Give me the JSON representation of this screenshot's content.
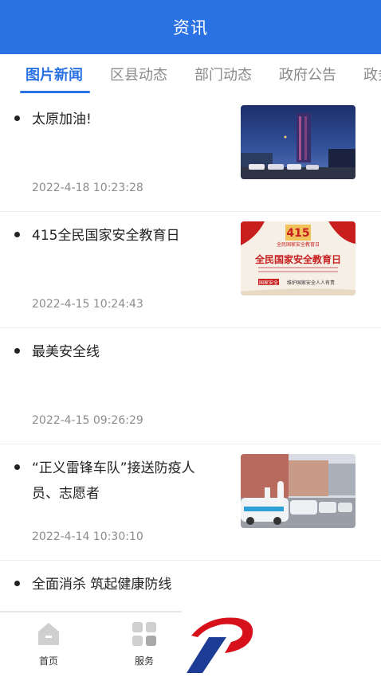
{
  "header": {
    "title": "资讯"
  },
  "tabs": [
    {
      "label": "图片新闻",
      "active": true
    },
    {
      "label": "区县动态",
      "active": false
    },
    {
      "label": "部门动态",
      "active": false
    },
    {
      "label": "政府公告",
      "active": false
    },
    {
      "label": "政务",
      "active": false
    }
  ],
  "news": [
    {
      "title": "太原加油!",
      "date": "2022-4-18 10:23:28",
      "image": "night-city-tower"
    },
    {
      "title": "415全民国家安全教育日",
      "date": "2022-4-15 10:24:43",
      "image": "security-day-poster",
      "poster": {
        "badge": "415",
        "subtitle": "全民国家安全教育日",
        "heading": "全民国家安全教育日",
        "footer_tag": "国家安全",
        "footer_text": "维护国家安全人人有责"
      }
    },
    {
      "title": "最美安全线",
      "date": "2022-4-15 09:26:29",
      "image": null
    },
    {
      "title": "“正义雷锋车队”接送防疫人员、志愿者",
      "date": "2022-4-14 10:30:10",
      "image": "taxi-convoy"
    },
    {
      "title": "全面消杀 筑起健康防线",
      "date": "",
      "image": null
    }
  ],
  "bottom_nav": [
    {
      "label": "首页",
      "icon": "home-icon"
    },
    {
      "label": "服务",
      "icon": "grid-icon"
    }
  ],
  "colors": {
    "brand": "#2a72e3",
    "logo_red": "#d7111c",
    "logo_blue": "#1c3c95"
  }
}
